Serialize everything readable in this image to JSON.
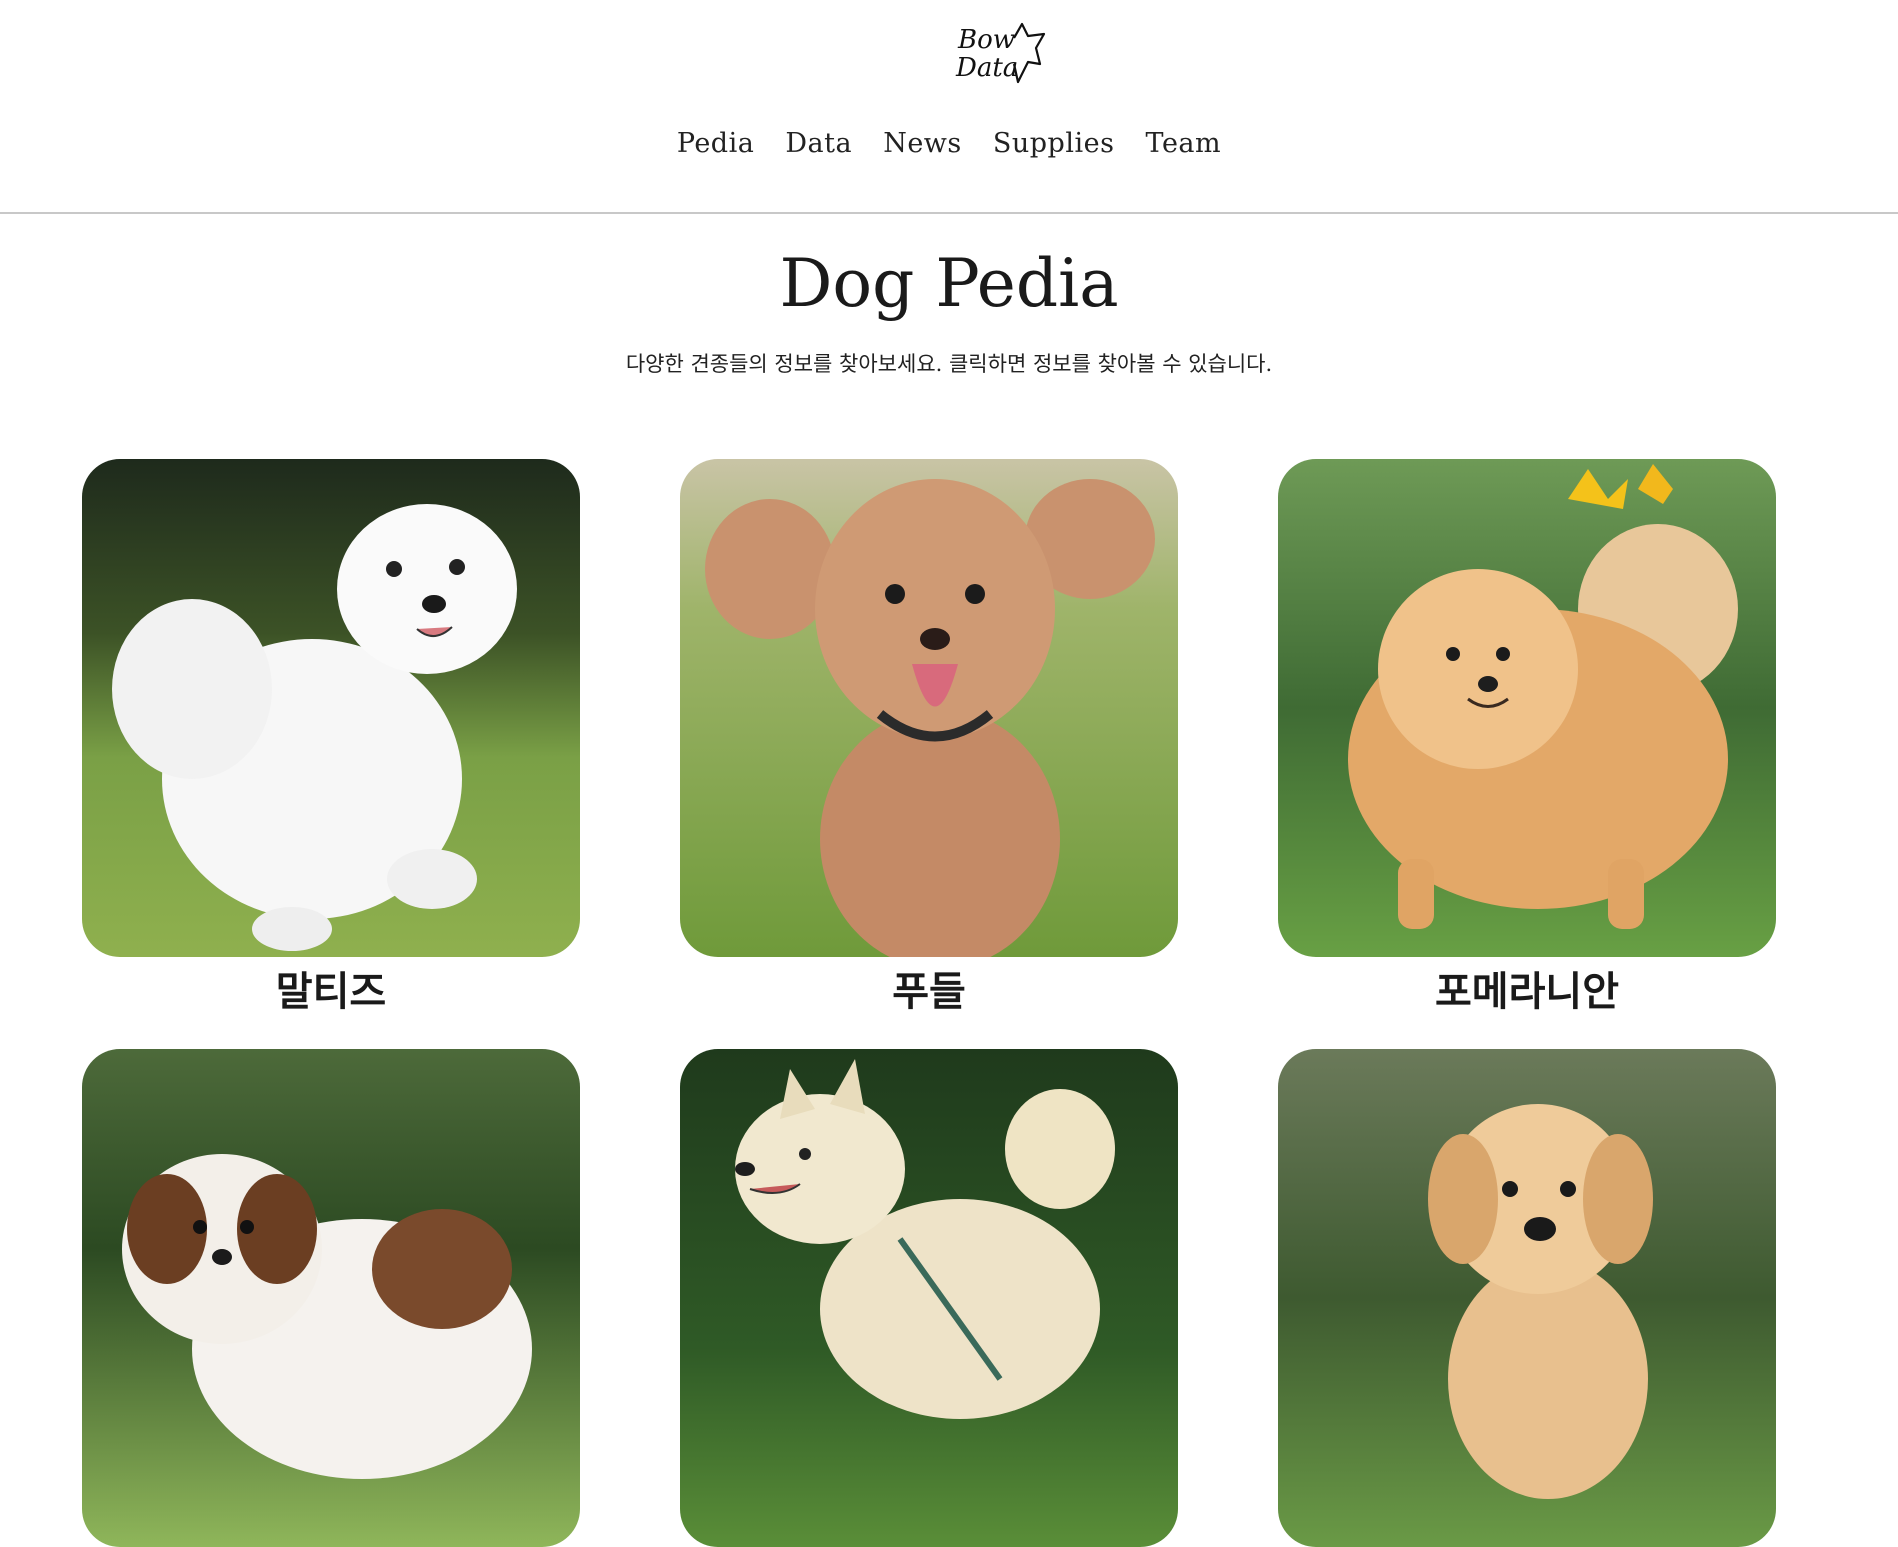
{
  "logo": {
    "name": "Bow Data",
    "icon": "dog-logo-icon"
  },
  "nav": {
    "items": [
      {
        "label": "Pedia"
      },
      {
        "label": "Data"
      },
      {
        "label": "News"
      },
      {
        "label": "Supplies"
      },
      {
        "label": "Team"
      }
    ]
  },
  "page": {
    "title": "Dog Pedia",
    "subtitle": "다양한 견종들의 정보를 찾아보세요. 클릭하면 정보를 찾아볼 수 있습니다."
  },
  "breeds": [
    {
      "name": "말티즈",
      "photo": "maltese-photo"
    },
    {
      "name": "푸들",
      "photo": "poodle-photo"
    },
    {
      "name": "포메라니안",
      "photo": "pomeranian-photo"
    },
    {
      "name": "",
      "photo": "shih-tzu-photo"
    },
    {
      "name": "",
      "photo": "jindo-photo"
    },
    {
      "name": "",
      "photo": "golden-retriever-photo"
    }
  ],
  "colors": {
    "divider": "#c8c8c8",
    "text": "#1a1a1a",
    "grass": "#6f9a3a"
  }
}
